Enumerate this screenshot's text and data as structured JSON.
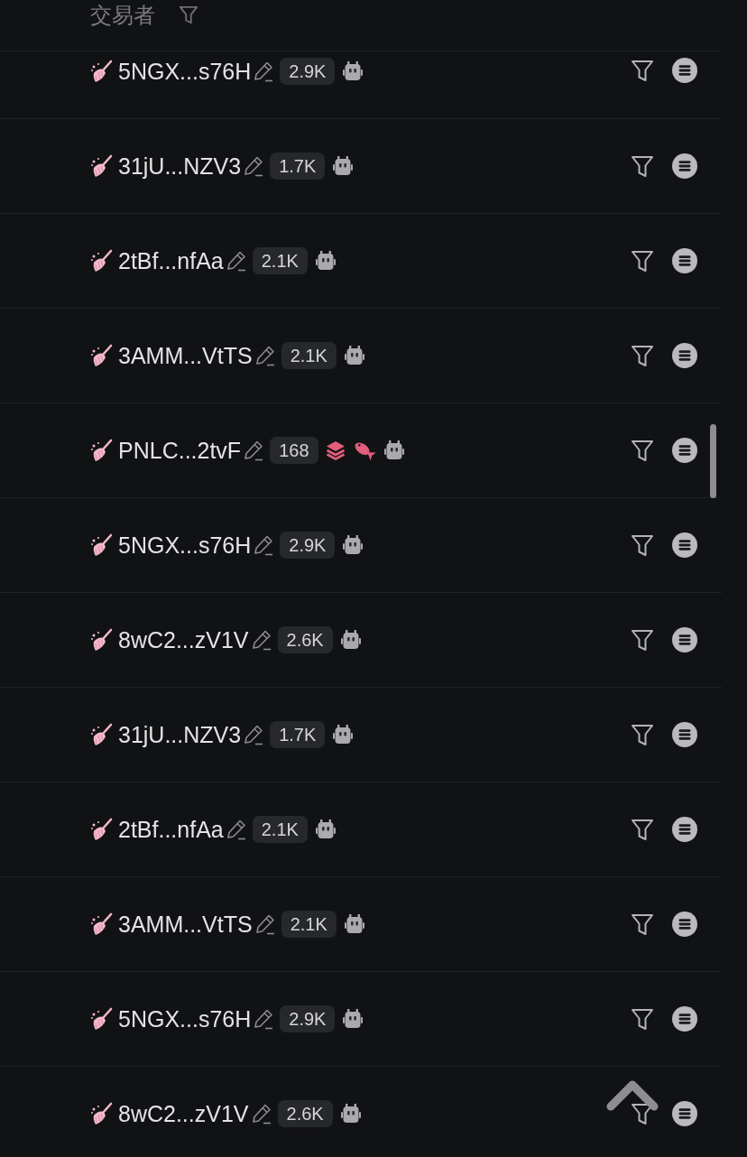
{
  "header": {
    "title": "交易者"
  },
  "rows": [
    {
      "address": "5NGX...s76H",
      "count": "2.9K"
    },
    {
      "address": "31jU...NZV3",
      "count": "1.7K"
    },
    {
      "address": "2tBf...nfAa",
      "count": "2.1K"
    },
    {
      "address": "3AMM...VtTS",
      "count": "2.1K"
    },
    {
      "address": "PNLC...2tvF",
      "count": "168",
      "tags": [
        {
          "kind": "layers"
        },
        {
          "kind": "fish"
        }
      ]
    },
    {
      "address": "5NGX...s76H",
      "count": "2.9K"
    },
    {
      "address": "8wC2...zV1V",
      "count": "2.6K"
    },
    {
      "address": "31jU...NZV3",
      "count": "1.7K"
    },
    {
      "address": "2tBf...nfAa",
      "count": "2.1K"
    },
    {
      "address": "3AMM...VtTS",
      "count": "2.1K"
    },
    {
      "address": "5NGX...s76H",
      "count": "2.9K"
    },
    {
      "address": "8wC2...zV1V",
      "count": "2.6K"
    }
  ]
}
